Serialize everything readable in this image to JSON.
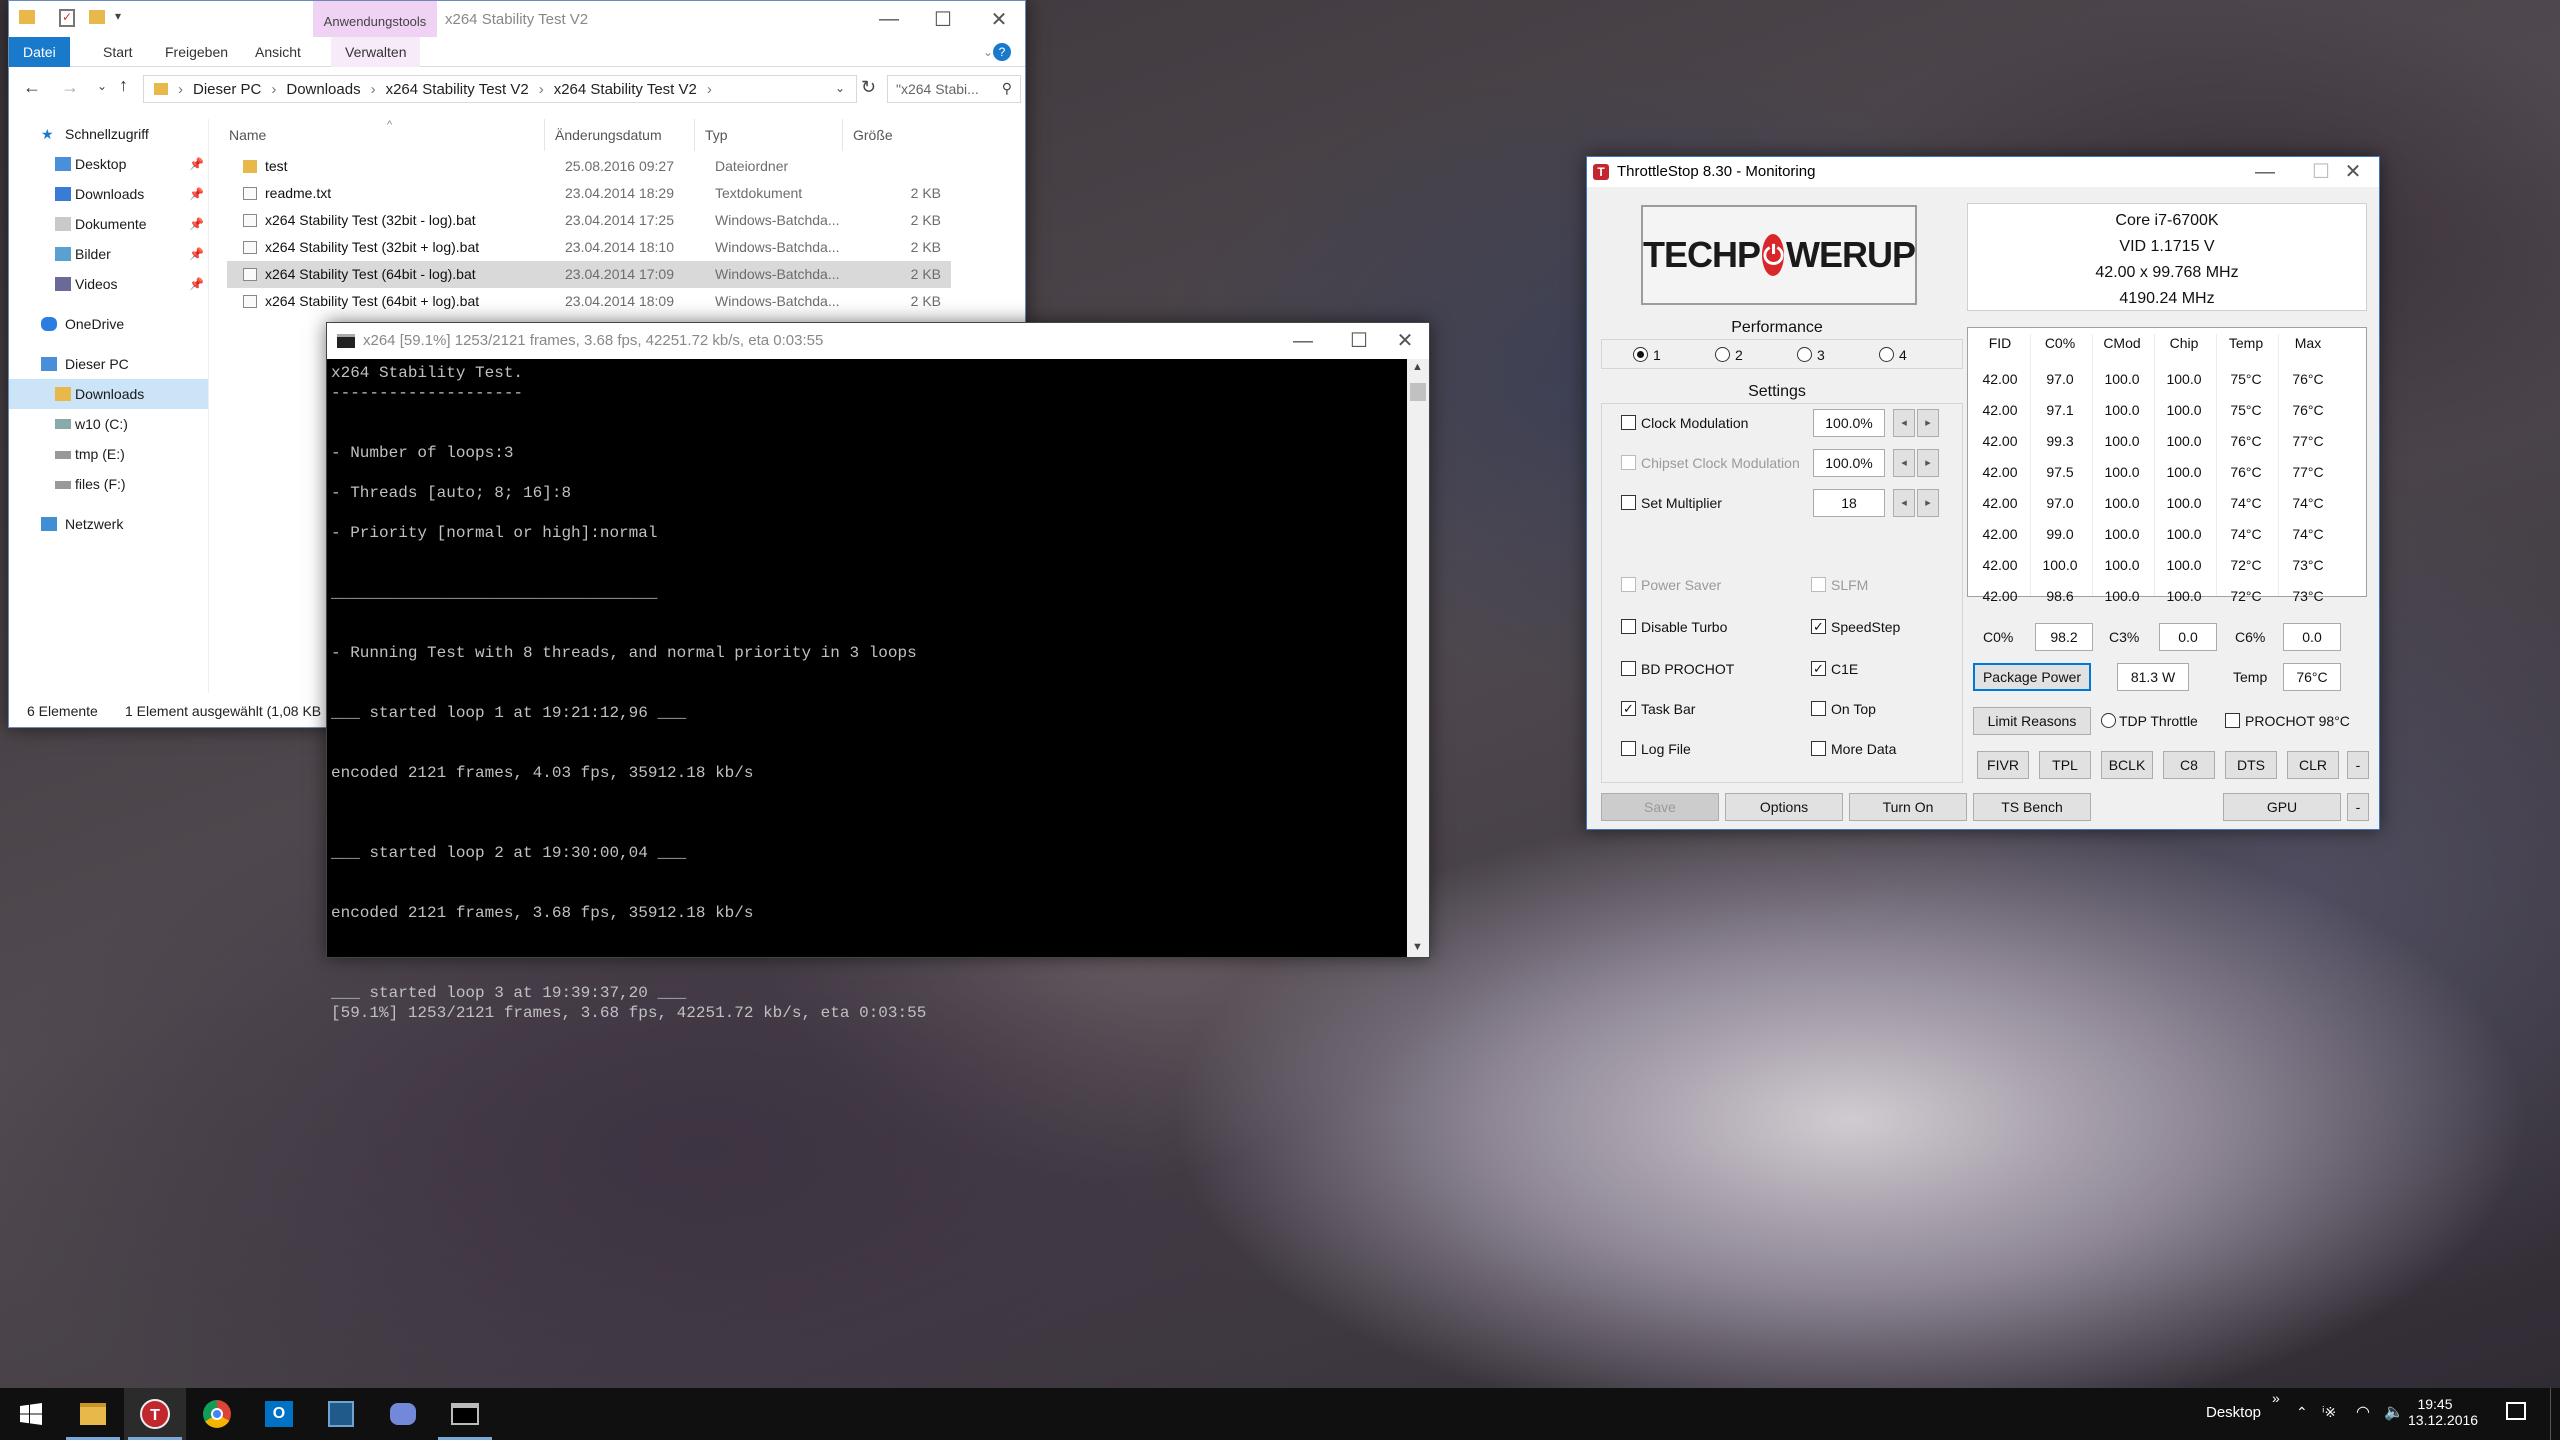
{
  "explorer": {
    "title": "x264 Stability Test V2",
    "context_tab": "Anwendungstools",
    "ribbon_tabs": [
      "Datei",
      "Start",
      "Freigeben",
      "Ansicht",
      "Verwalten"
    ],
    "breadcrumb": [
      "Dieser PC",
      "Downloads",
      "x264 Stability Test V2",
      "x264 Stability Test V2"
    ],
    "search_placeholder": "\"x264 Stabi...",
    "nav": [
      "Schnellzugriff",
      "Desktop",
      "Downloads",
      "Dokumente",
      "Bilder",
      "Videos",
      "OneDrive",
      "Dieser PC",
      "Downloads",
      "w10 (C:)",
      "tmp (E:)",
      "files (F:)",
      "Netzwerk"
    ],
    "columns": [
      "Name",
      "Änderungsdatum",
      "Typ",
      "Größe"
    ],
    "files": [
      {
        "name": "test",
        "date": "25.08.2016 09:27",
        "type": "Dateiordner",
        "size": ""
      },
      {
        "name": "readme.txt",
        "date": "23.04.2014 18:29",
        "type": "Textdokument",
        "size": "2 KB"
      },
      {
        "name": "x264 Stability Test (32bit - log).bat",
        "date": "23.04.2014 17:25",
        "type": "Windows-Batchda...",
        "size": "2 KB"
      },
      {
        "name": "x264 Stability Test (32bit + log).bat",
        "date": "23.04.2014 18:10",
        "type": "Windows-Batchda...",
        "size": "2 KB"
      },
      {
        "name": "x264 Stability Test (64bit - log).bat",
        "date": "23.04.2014 17:09",
        "type": "Windows-Batchda...",
        "size": "2 KB"
      },
      {
        "name": "x264 Stability Test (64bit + log).bat",
        "date": "23.04.2014 18:09",
        "type": "Windows-Batchda...",
        "size": "2 KB"
      }
    ],
    "status_count": "6 Elemente",
    "status_selected": "1 Element ausgewählt (1,08 KB"
  },
  "cmd": {
    "title": "x264 [59.1%] 1253/2121 frames, 3.68 fps, 42251.72 kb/s, eta 0:03:55",
    "lines": [
      "x264 Stability Test.",
      "--------------------",
      "",
      "",
      "- Number of loops:3",
      "",
      "- Threads [auto; 8; 16]:8",
      "",
      "- Priority [normal or high]:normal",
      "",
      "",
      "__________________________________",
      "",
      "",
      "- Running Test with 8 threads, and normal priority in 3 loops",
      "",
      "",
      "___ started loop 1 at 19:21:12,96 ___",
      "",
      "",
      "encoded 2121 frames, 4.03 fps, 35912.18 kb/s",
      "",
      "",
      "",
      "___ started loop 2 at 19:30:00,04 ___",
      "",
      "",
      "encoded 2121 frames, 3.68 fps, 35912.18 kb/s",
      "",
      "",
      "",
      "___ started loop 3 at 19:39:37,20 ___",
      "[59.1%] 1253/2121 frames, 3.68 fps, 42251.72 kb/s, eta 0:03:55"
    ]
  },
  "ts": {
    "title": "ThrottleStop 8.30 - Monitoring",
    "logo_a": "TECHP",
    "logo_o": "⏻",
    "logo_b": "WERUP",
    "performance_label": "Performance",
    "profiles": [
      "1",
      "2",
      "3",
      "4"
    ],
    "settings_label": "Settings",
    "clock_mod": "Clock Modulation",
    "clock_mod_val": "100.0%",
    "chipset_mod": "Chipset Clock Modulation",
    "chipset_mod_val": "100.0%",
    "set_mult": "Set Multiplier",
    "set_mult_val": "18",
    "power_saver": "Power Saver",
    "slfm": "SLFM",
    "disable_turbo": "Disable Turbo",
    "speedstep": "SpeedStep",
    "bd_prochot": "BD PROCHOT",
    "c1e": "C1E",
    "task_bar": "Task Bar",
    "on_top": "On Top",
    "log_file": "Log File",
    "more_data": "More Data",
    "cpu": "Core i7-6700K",
    "vid": "VID  1.1715 V",
    "freq1": "42.00 x 99.768 MHz",
    "freq2": "4190.24 MHz",
    "grid_headers": [
      "FID",
      "C0%",
      "CMod",
      "Chip",
      "Temp",
      "Max"
    ],
    "grid_rows": [
      [
        "42.00",
        "97.0",
        "100.0",
        "100.0",
        "75°C",
        "76°C"
      ],
      [
        "42.00",
        "97.1",
        "100.0",
        "100.0",
        "75°C",
        "76°C"
      ],
      [
        "42.00",
        "99.3",
        "100.0",
        "100.0",
        "76°C",
        "77°C"
      ],
      [
        "42.00",
        "97.5",
        "100.0",
        "100.0",
        "76°C",
        "77°C"
      ],
      [
        "42.00",
        "97.0",
        "100.0",
        "100.0",
        "74°C",
        "74°C"
      ],
      [
        "42.00",
        "99.0",
        "100.0",
        "100.0",
        "74°C",
        "74°C"
      ],
      [
        "42.00",
        "100.0",
        "100.0",
        "100.0",
        "72°C",
        "73°C"
      ],
      [
        "42.00",
        "98.6",
        "100.0",
        "100.0",
        "72°C",
        "73°C"
      ]
    ],
    "c0_label": "C0%",
    "c0_val": "98.2",
    "c3_label": "C3%",
    "c3_val": "0.0",
    "c6_label": "C6%",
    "c6_val": "0.0",
    "pkg_power": "Package Power",
    "pkg_val": "81.3 W",
    "temp_label": "Temp",
    "temp_val": "76°C",
    "limit_reasons": "Limit Reasons",
    "tdp_throttle": "TDP Throttle",
    "prochot": "PROCHOT 98°C",
    "tools": [
      "FIVR",
      "TPL",
      "BCLK",
      "C8",
      "DTS",
      "CLR",
      "-"
    ],
    "save": "Save",
    "options": "Options",
    "turn_on": "Turn On",
    "ts_bench": "TS Bench",
    "gpu": "GPU",
    "minus": "-"
  },
  "taskbar": {
    "desktop": "Desktop",
    "time": "19:45",
    "date": "13.12.2016"
  }
}
